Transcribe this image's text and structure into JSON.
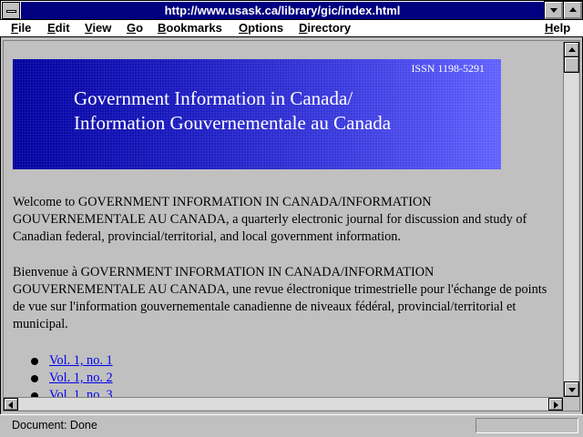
{
  "window": {
    "title": "http://www.usask.ca/library/gic/index.html"
  },
  "menubar": {
    "items": [
      {
        "label": "File",
        "accesskey": "F"
      },
      {
        "label": "Edit",
        "accesskey": "E"
      },
      {
        "label": "View",
        "accesskey": "V"
      },
      {
        "label": "Go",
        "accesskey": "G"
      },
      {
        "label": "Bookmarks",
        "accesskey": "B"
      },
      {
        "label": "Options",
        "accesskey": "O"
      },
      {
        "label": "Directory",
        "accesskey": "D"
      },
      {
        "label": "Help",
        "accesskey": "H"
      }
    ]
  },
  "page": {
    "banner": {
      "issn": "ISSN 1198-5291",
      "title_line1": "Government Information in Canada/",
      "title_line2": "Information Gouvernementale au Canada"
    },
    "paragraph_en": "Welcome to GOVERNMENT INFORMATION IN CANADA/INFORMATION GOUVERNEMENTALE AU CANADA, a quarterly electronic journal for discussion and study of Canadian federal, provincial/territorial, and local government information.",
    "paragraph_fr": "Bienvenue à GOVERNMENT INFORMATION IN CANADA/INFORMATION GOUVERNEMENTALE AU CANADA, une revue électronique trimestrielle pour l'échange de points de vue sur l'information gouvernementale canadienne de niveaux fédéral, provincial/territorial et municipal.",
    "issues": [
      {
        "label": "Vol. 1, no. 1"
      },
      {
        "label": "Vol. 1, no. 2"
      },
      {
        "label": "Vol. 1, no. 3"
      }
    ]
  },
  "statusbar": {
    "text": "Document: Done"
  },
  "colors": {
    "title_active": "#000080",
    "link": "#0000ee",
    "chrome": "#c0c0c0"
  }
}
